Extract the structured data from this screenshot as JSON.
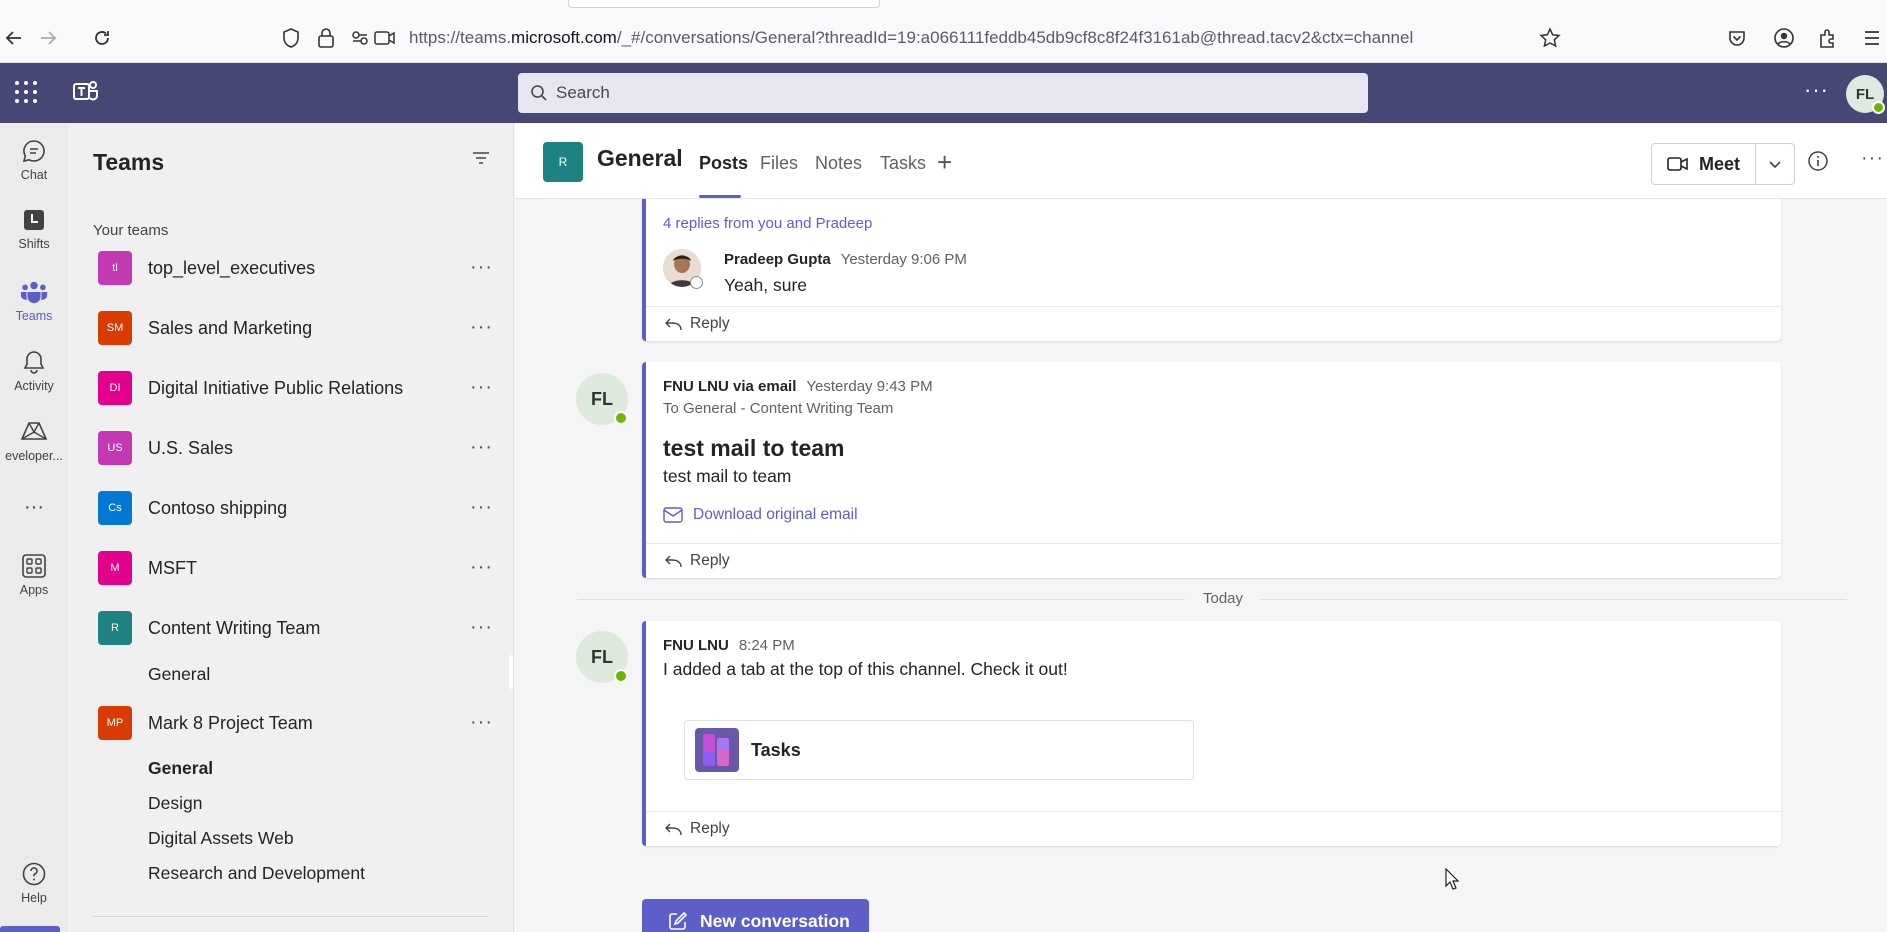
{
  "browser": {
    "url_prefix": "https://teams.",
    "url_domain": "microsoft.com",
    "url_rest": "/_#/conversations/General?threadId=19:a066111feddb45db9cf8c8f24f3161ab@thread.tacv2&ctx=channel"
  },
  "topbar": {
    "search_placeholder": "Search",
    "user_initials": "FL",
    "more_label": "···"
  },
  "rail": {
    "items": [
      {
        "label": "Chat",
        "icon": "chat-icon"
      },
      {
        "label": "Shifts",
        "icon": "shifts-icon"
      },
      {
        "label": "Teams",
        "icon": "teams-icon"
      },
      {
        "label": "Activity",
        "icon": "bell-icon"
      },
      {
        "label": "eveloper...",
        "icon": "developer-icon"
      },
      {
        "label": "Apps",
        "icon": "apps-icon"
      },
      {
        "label": "Help",
        "icon": "help-icon"
      }
    ],
    "more_label": "···",
    "accent": "#5b5fc7"
  },
  "teams_pane": {
    "title": "Teams",
    "section_label": "Your teams",
    "teams": [
      {
        "initials": "tl",
        "name": "top_level_executives",
        "color": "#c239b3"
      },
      {
        "initials": "SM",
        "name": "Sales and Marketing",
        "color": "#da3b01"
      },
      {
        "initials": "DI",
        "name": "Digital Initiative Public Relations",
        "color": "#e3008c"
      },
      {
        "initials": "US",
        "name": "U.S. Sales",
        "color": "#c239b3"
      },
      {
        "initials": "Cs",
        "name": "Contoso shipping",
        "color": "#0078d4"
      },
      {
        "initials": "M",
        "name": "MSFT",
        "color": "#e3008c"
      },
      {
        "initials": "R",
        "name": "Content Writing Team",
        "color": "#1f8282"
      },
      {
        "initials": "MP",
        "name": "Mark 8 Project Team",
        "color": "#da3b01"
      }
    ],
    "content_writing_channels": [
      "General"
    ],
    "mark8_channels": [
      "General",
      "Design",
      "Digital Assets Web",
      "Research and Development"
    ],
    "more_label": "···"
  },
  "channel": {
    "tile_initial": "R",
    "name": "General",
    "tabs": [
      "Posts",
      "Files",
      "Notes",
      "Tasks"
    ],
    "add_tab": "+",
    "meet_label": "Meet",
    "more_label": "···"
  },
  "feed": {
    "thread1": {
      "replies_summary": "4 replies from you and Pradeep",
      "reply_author": "Pradeep Gupta",
      "reply_time": "Yesterday 9:06 PM",
      "reply_text": "Yeah, sure",
      "reply_label": "Reply"
    },
    "thread2": {
      "avatar": "FL",
      "author": "FNU LNU via email",
      "time": "Yesterday 9:43 PM",
      "to_line": "To General - Content Writing Team",
      "subject": "test mail to team",
      "body": "test mail to team",
      "download_label": "Download original email",
      "reply_label": "Reply"
    },
    "divider": "Today",
    "thread3": {
      "avatar": "FL",
      "author": "FNU LNU",
      "time": "8:24 PM",
      "text": "I added a tab at the top of this channel. Check it out!",
      "card_title": "Tasks",
      "reply_label": "Reply"
    },
    "new_conversation": "New conversation"
  }
}
